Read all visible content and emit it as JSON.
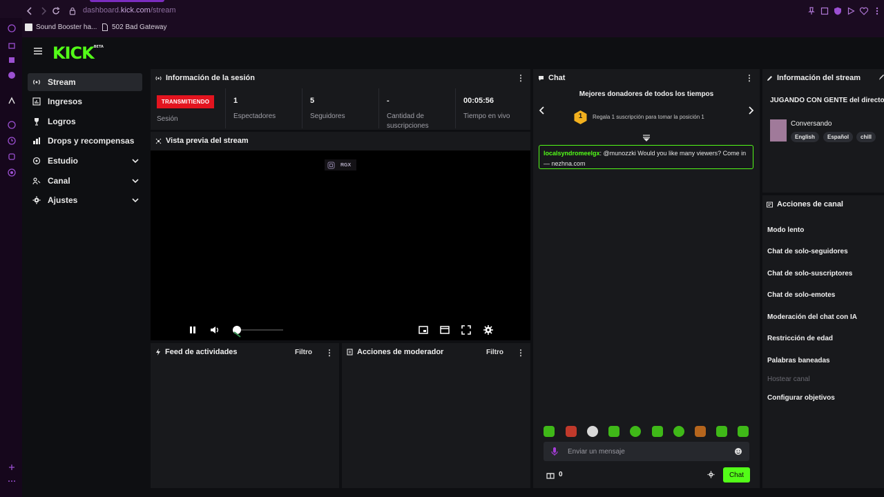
{
  "browser": {
    "url_prefix": "dashboard.",
    "url_domain": "kick.com",
    "url_path": "/stream",
    "bookmarks": [
      "Sound Booster ha...",
      "502 Bad Gateway"
    ]
  },
  "brand": {
    "logo": "KICK",
    "badge": "BETA",
    "color": "#53fc18"
  },
  "sidebar": {
    "items": [
      {
        "label": "Stream",
        "icon": "stream-icon"
      },
      {
        "label": "Ingresos",
        "icon": "chart-icon"
      },
      {
        "label": "Logros",
        "icon": "trophy-icon"
      },
      {
        "label": "Drops y recompensas",
        "icon": "drops-icon"
      },
      {
        "label": "Estudio",
        "icon": "studio-icon"
      },
      {
        "label": "Canal",
        "icon": "channel-icon"
      },
      {
        "label": "Ajustes",
        "icon": "gear-icon"
      }
    ]
  },
  "session": {
    "title": "Información de la sesión",
    "status_badge": "TRANSMITIENDO",
    "status_label": "Sesión",
    "stats": [
      {
        "value": "1",
        "label": "Espectadores"
      },
      {
        "value": "5",
        "label": "Seguidores"
      },
      {
        "value": "-",
        "label": "Cantidad de suscripciones"
      },
      {
        "value": "00:05:56",
        "label": "Tiempo en vivo"
      }
    ]
  },
  "preview": {
    "title": "Vista previa del stream",
    "overlay_label": "RGX",
    "volume_level": 0.0
  },
  "activity_feed": {
    "title": "Feed de actividades",
    "filter": "Filtro"
  },
  "mod_actions": {
    "title": "Acciones de moderador",
    "filter": "Filtro"
  },
  "chat": {
    "title": "Chat",
    "donors_title": "Mejores donadores de todos los tiempos",
    "donor_rank": "1",
    "donor_desc": "Regala 1 suscripción para tomar la posición 1",
    "messages": [
      {
        "user": "localsyndromeelgx",
        "text": ": @munozzki Would you like many viewers? Come in — nezhna.com"
      }
    ],
    "input_placeholder": "Enviar un mensaje",
    "count": "0",
    "send_label": "Chat"
  },
  "stream_info": {
    "title": "Información del stream",
    "stream_title": "JUGANDO CON GENTE del directo [jugando cualquier cosa]",
    "category": "Conversando",
    "tags": [
      "English",
      "Español",
      "chill"
    ]
  },
  "channel_actions": {
    "title": "Acciones de canal",
    "items": [
      {
        "label": "Modo lento",
        "enabled": true
      },
      {
        "label": "Chat de solo-seguidores",
        "enabled": true
      },
      {
        "label": "Chat de solo-suscriptores",
        "enabled": true
      },
      {
        "label": "Chat de solo-emotes",
        "enabled": true
      },
      {
        "label": "Moderación del chat con IA",
        "enabled": true
      },
      {
        "label": "Restricción de edad",
        "enabled": true
      },
      {
        "label": "Palabras baneadas",
        "enabled": true
      },
      {
        "label": "Hostear canal",
        "enabled": false
      },
      {
        "label": "Configurar objetivos",
        "enabled": true
      }
    ]
  }
}
